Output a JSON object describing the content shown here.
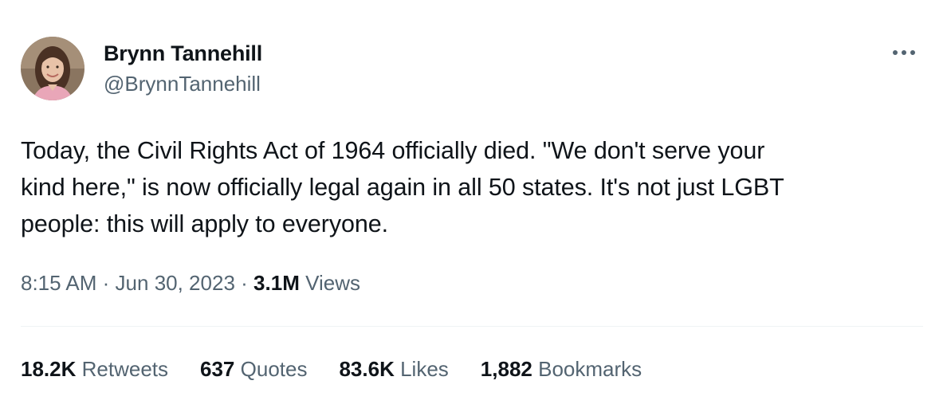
{
  "author": {
    "display_name": "Brynn Tannehill",
    "handle": "@BrynnTannehill"
  },
  "tweet": {
    "lines": [
      "Today, the Civil Rights Act of 1964 officially died. \"We don't serve your",
      "kind here,\" is now officially legal again in all 50 states. It's not just LGBT",
      "people: this will apply to everyone."
    ],
    "time": "8:15 AM",
    "date": "Jun 30, 2023",
    "separator": "·",
    "views_count": "3.1M",
    "views_label": "Views"
  },
  "stats": {
    "retweets": {
      "count": "18.2K",
      "label": "Retweets"
    },
    "quotes": {
      "count": "637",
      "label": "Quotes"
    },
    "likes": {
      "count": "83.6K",
      "label": "Likes"
    },
    "bookmarks": {
      "count": "1,882",
      "label": "Bookmarks"
    }
  },
  "icons": {
    "more": "more-horizontal-icon"
  },
  "colors": {
    "text_primary": "#0f1419",
    "text_secondary": "#536471",
    "divider": "#eff3f4"
  }
}
